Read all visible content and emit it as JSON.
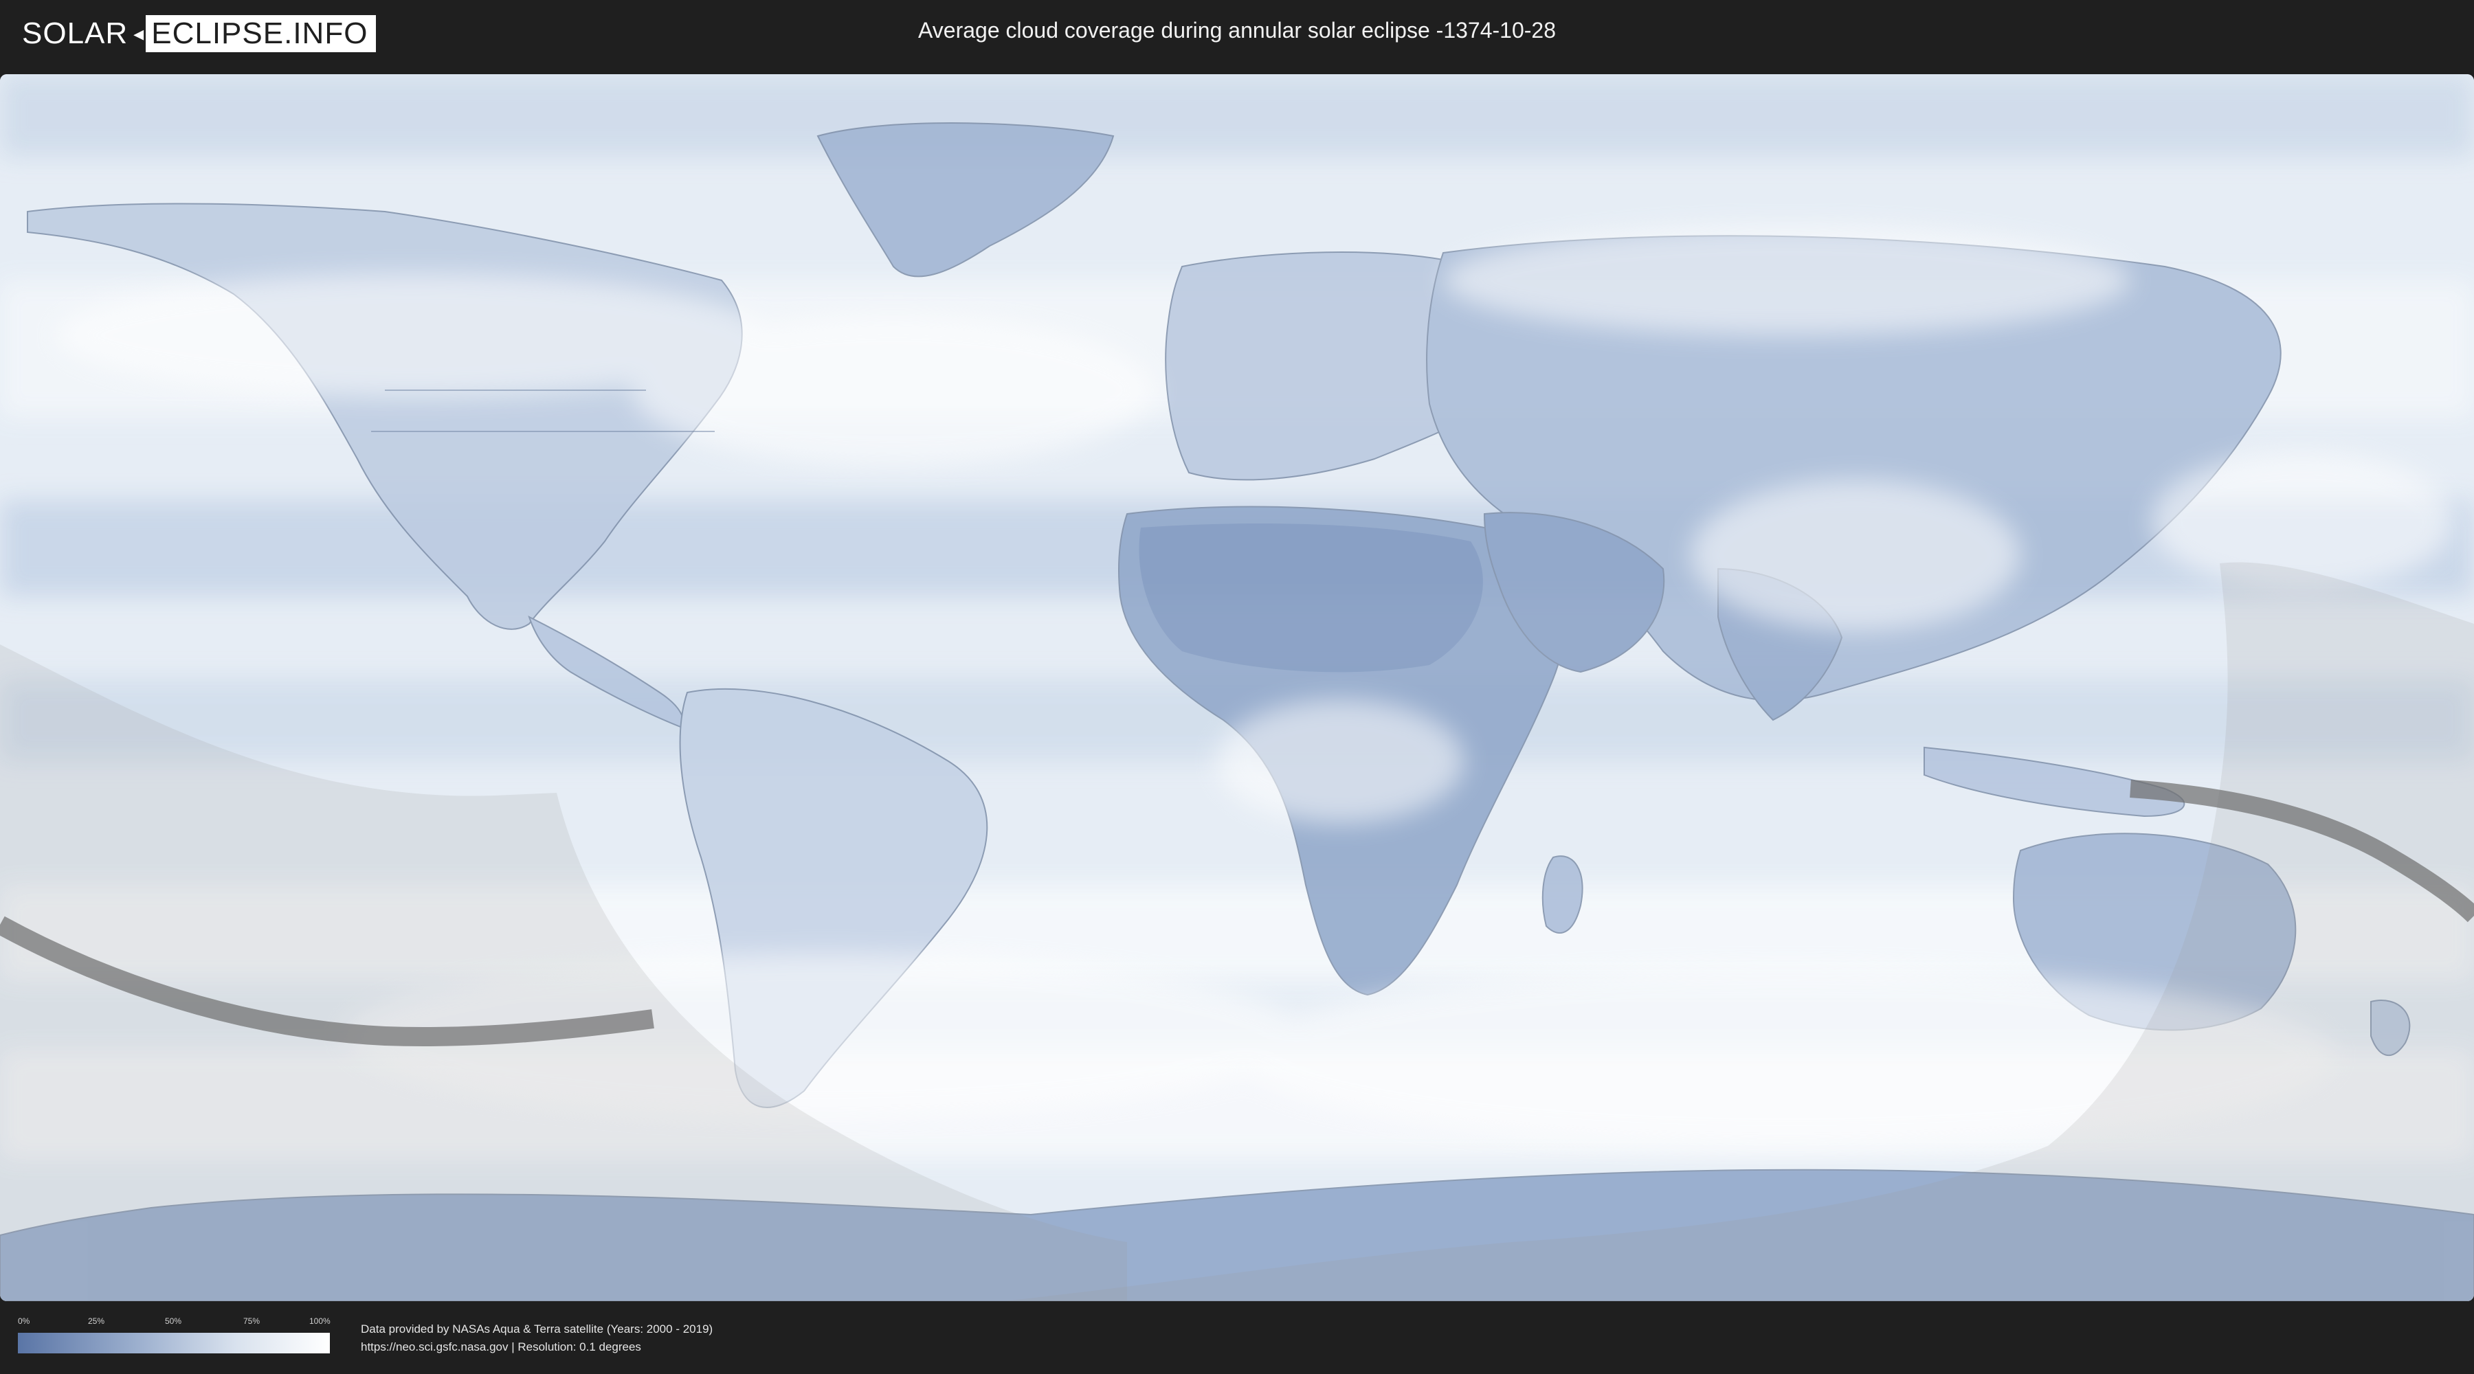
{
  "header": {
    "logo_part1": "SOLAR",
    "logo_part2": "ECLIPSE.INFO",
    "title": "Average cloud coverage during annular solar eclipse -1374-10-28"
  },
  "legend": {
    "ticks": [
      "0%",
      "25%",
      "50%",
      "75%",
      "100%"
    ],
    "color_low": "#5a75a6",
    "color_high": "#ffffff"
  },
  "credits": {
    "line1": "Data provided by NASAs Aqua & Terra satellite (Years: 2000 - 2019)",
    "line2": "https://neo.sci.gsfc.nasa.gov | Resolution: 0.1 degrees"
  },
  "map": {
    "ocean_color": "#e4ebf4",
    "land_color": "#8aa2c6",
    "cloudy_color": "#ffffff",
    "shadow_color": "#9a9a9a",
    "path_color": "#6e6e6e"
  }
}
